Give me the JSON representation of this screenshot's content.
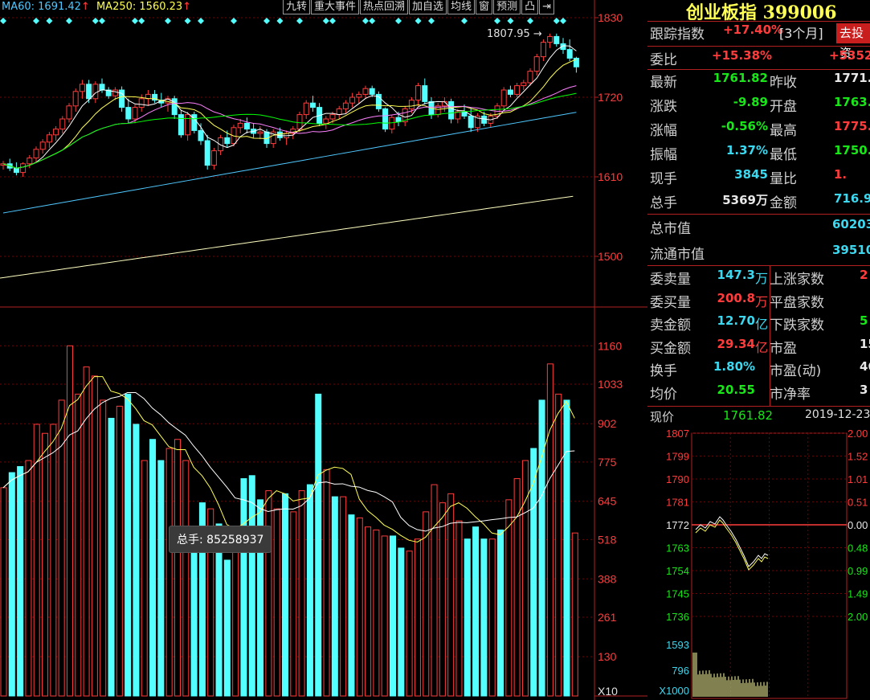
{
  "ma_legend": {
    "ma60": "MA60: 1691.42",
    "ma250": "MA250: 1560.23",
    "arrow": "↑",
    "ma60_color": "#4fc8ff",
    "ma250_color": "#ffff54"
  },
  "toolbar": [
    "九转",
    "重大事件",
    "热点回溯",
    "加自选",
    "均线",
    "窗",
    "预测",
    "凸",
    "⇥"
  ],
  "price_axis": {
    "labels": [
      "1830",
      "1720",
      "1610",
      "1500"
    ],
    "min": 1430,
    "max": 1830
  },
  "peak_label": "1807.95",
  "volume_axis": {
    "labels": [
      "1160",
      "1033",
      "902",
      "775",
      "645",
      "518",
      "388",
      "261",
      "130",
      "X10"
    ]
  },
  "tooltip": {
    "text": "总手: 85258937"
  },
  "index": {
    "title": "创业板指 399006"
  },
  "quote": {
    "track": {
      "label": "跟踪指数",
      "value": "+17.40%",
      "period": "[3个月]",
      "button": "去投资"
    },
    "weibi": {
      "label": "委比",
      "value": "+15.38%",
      "value2": "+5352"
    },
    "rows": [
      {
        "l1": "最新",
        "v1": "1761.82",
        "c1": "grn",
        "l2": "昨收",
        "v2": "1771.",
        "c2": "wht"
      },
      {
        "l1": "涨跌",
        "v1": "-9.89",
        "c1": "grn",
        "l2": "开盘",
        "v2": "1763.",
        "c2": "grn"
      },
      {
        "l1": "涨幅",
        "v1": "-0.56%",
        "c1": "grn",
        "l2": "最高",
        "v2": "1775.",
        "c2": "red"
      },
      {
        "l1": "振幅",
        "v1": "1.37%",
        "c1": "cyn",
        "l2": "最低",
        "v2": "1750.",
        "c2": "grn"
      },
      {
        "l1": "现手",
        "v1": "3845",
        "c1": "cyn",
        "l2": "量比",
        "v2": "1.",
        "c2": "red"
      },
      {
        "l1": "总手",
        "v1": "5369万",
        "c1": "wht",
        "l2": "金额",
        "v2": "716.9",
        "c2": "cyn"
      }
    ],
    "mktcap": {
      "label": "总市值",
      "value": "60203"
    },
    "floatcap": {
      "label": "流通市值",
      "value": "39510"
    },
    "rows2": [
      {
        "l1": "委卖量",
        "v1": "147.3",
        "u1": "万",
        "c1": "cyn",
        "l2": "上涨家数",
        "v2": "2",
        "c2": "red"
      },
      {
        "l1": "委买量",
        "v1": "200.8",
        "u1": "万",
        "c1": "red",
        "l2": "平盘家数",
        "v2": "",
        "c2": "wht"
      },
      {
        "l1": "卖金额",
        "v1": "12.70",
        "u1": "亿",
        "c1": "cyn",
        "l2": "下跌家数",
        "v2": "5",
        "c2": "grn"
      },
      {
        "l1": "买金额",
        "v1": "29.34",
        "u1": "亿",
        "c1": "red",
        "l2": "市盈",
        "v2": "15",
        "c2": "wht"
      },
      {
        "l1": "换手",
        "v1": "1.80%",
        "u1": "",
        "c1": "cyn",
        "l2": "市盈(动)",
        "v2": "46",
        "c2": "wht"
      },
      {
        "l1": "均价",
        "v1": "20.55",
        "u1": "",
        "c1": "grn",
        "l2": "市净率",
        "v2": "3",
        "c2": "wht"
      }
    ]
  },
  "mini": {
    "label": "现价",
    "price": "1761.82",
    "date": "2019-12-23",
    "left_labels": [
      "1807",
      "1799",
      "1790",
      "1781",
      "1772",
      "1763",
      "1754",
      "1745",
      "1736"
    ],
    "right_labels": [
      "2.00",
      "1.52",
      "1.01",
      "0.51",
      "0.00",
      "0.48",
      "0.99",
      "1.49",
      "2.00"
    ],
    "vol_labels": [
      "1593",
      "796",
      "X1000"
    ]
  },
  "colors": {
    "up": "#ff3c3c",
    "down": "#54ffff",
    "ma5": "#ffffff",
    "ma10": "#ffff54",
    "ma20": "#ff80ff",
    "ma30": "#00ff00",
    "ma60": "#4fc8ff",
    "ma250": "#ffffc0",
    "grid": "#7a0000"
  },
  "chart_data": {
    "type": "candlestick",
    "price_ylim": [
      1430,
      1830
    ],
    "candles": [
      [
        1626,
        1632,
        1620,
        1628
      ],
      [
        1628,
        1635,
        1618,
        1622
      ],
      [
        1622,
        1630,
        1612,
        1616
      ],
      [
        1616,
        1630,
        1610,
        1628
      ],
      [
        1628,
        1640,
        1622,
        1636
      ],
      [
        1636,
        1652,
        1630,
        1648
      ],
      [
        1648,
        1662,
        1642,
        1658
      ],
      [
        1658,
        1672,
        1650,
        1668
      ],
      [
        1668,
        1680,
        1660,
        1676
      ],
      [
        1676,
        1694,
        1670,
        1690
      ],
      [
        1690,
        1712,
        1685,
        1708
      ],
      [
        1708,
        1732,
        1700,
        1728
      ],
      [
        1728,
        1744,
        1718,
        1738
      ],
      [
        1738,
        1744,
        1712,
        1718
      ],
      [
        1718,
        1742,
        1712,
        1738
      ],
      [
        1738,
        1746,
        1726,
        1730
      ],
      [
        1730,
        1734,
        1718,
        1722
      ],
      [
        1722,
        1734,
        1716,
        1730
      ],
      [
        1730,
        1735,
        1700,
        1706
      ],
      [
        1706,
        1718,
        1684,
        1690
      ],
      [
        1690,
        1710,
        1684,
        1706
      ],
      [
        1706,
        1724,
        1700,
        1718
      ],
      [
        1718,
        1730,
        1708,
        1724
      ],
      [
        1724,
        1730,
        1712,
        1716
      ],
      [
        1716,
        1726,
        1706,
        1712
      ],
      [
        1712,
        1722,
        1700,
        1718
      ],
      [
        1718,
        1722,
        1690,
        1696
      ],
      [
        1696,
        1702,
        1664,
        1668
      ],
      [
        1668,
        1700,
        1660,
        1696
      ],
      [
        1696,
        1700,
        1670,
        1674
      ],
      [
        1674,
        1684,
        1654,
        1660
      ],
      [
        1660,
        1668,
        1620,
        1626
      ],
      [
        1626,
        1650,
        1620,
        1646
      ],
      [
        1646,
        1668,
        1640,
        1664
      ],
      [
        1664,
        1674,
        1650,
        1656
      ],
      [
        1656,
        1682,
        1652,
        1678
      ],
      [
        1678,
        1690,
        1670,
        1684
      ],
      [
        1684,
        1692,
        1670,
        1676
      ],
      [
        1676,
        1684,
        1664,
        1670
      ],
      [
        1670,
        1680,
        1662,
        1672
      ],
      [
        1672,
        1676,
        1650,
        1656
      ],
      [
        1656,
        1676,
        1650,
        1672
      ],
      [
        1672,
        1678,
        1660,
        1664
      ],
      [
        1664,
        1674,
        1654,
        1670
      ],
      [
        1670,
        1680,
        1662,
        1676
      ],
      [
        1676,
        1700,
        1672,
        1696
      ],
      [
        1696,
        1716,
        1690,
        1712
      ],
      [
        1712,
        1722,
        1700,
        1706
      ],
      [
        1706,
        1712,
        1680,
        1684
      ],
      [
        1684,
        1694,
        1676,
        1690
      ],
      [
        1690,
        1700,
        1684,
        1696
      ],
      [
        1696,
        1708,
        1690,
        1704
      ],
      [
        1704,
        1716,
        1698,
        1712
      ],
      [
        1712,
        1726,
        1706,
        1720
      ],
      [
        1720,
        1728,
        1712,
        1724
      ],
      [
        1724,
        1736,
        1718,
        1732
      ],
      [
        1732,
        1736,
        1720,
        1724
      ],
      [
        1724,
        1728,
        1700,
        1704
      ],
      [
        1704,
        1706,
        1672,
        1676
      ],
      [
        1676,
        1696,
        1670,
        1692
      ],
      [
        1692,
        1700,
        1680,
        1686
      ],
      [
        1686,
        1708,
        1680,
        1704
      ],
      [
        1704,
        1720,
        1698,
        1716
      ],
      [
        1716,
        1740,
        1708,
        1736
      ],
      [
        1736,
        1746,
        1710,
        1714
      ],
      [
        1714,
        1720,
        1690,
        1696
      ],
      [
        1696,
        1712,
        1692,
        1708
      ],
      [
        1708,
        1720,
        1700,
        1714
      ],
      [
        1714,
        1718,
        1684,
        1690
      ],
      [
        1690,
        1704,
        1684,
        1700
      ],
      [
        1700,
        1710,
        1690,
        1694
      ],
      [
        1694,
        1706,
        1672,
        1678
      ],
      [
        1678,
        1698,
        1672,
        1694
      ],
      [
        1694,
        1700,
        1680,
        1684
      ],
      [
        1684,
        1698,
        1678,
        1694
      ],
      [
        1694,
        1712,
        1690,
        1708
      ],
      [
        1708,
        1734,
        1702,
        1730
      ],
      [
        1730,
        1736,
        1720,
        1724
      ],
      [
        1724,
        1740,
        1720,
        1736
      ],
      [
        1736,
        1744,
        1730,
        1740
      ],
      [
        1740,
        1760,
        1736,
        1756
      ],
      [
        1756,
        1780,
        1750,
        1776
      ],
      [
        1776,
        1800,
        1770,
        1796
      ],
      [
        1796,
        1808,
        1788,
        1804
      ],
      [
        1804,
        1808,
        1790,
        1794
      ],
      [
        1794,
        1802,
        1780,
        1786
      ],
      [
        1786,
        1800,
        1770,
        1774
      ],
      [
        1774,
        1776,
        1754,
        1762
      ]
    ],
    "volumes": [
      690,
      740,
      760,
      780,
      900,
      870,
      900,
      980,
      1160,
      1000,
      1090,
      1060,
      980,
      920,
      960,
      1000,
      900,
      780,
      850,
      780,
      820,
      850,
      780,
      560,
      640,
      620,
      570,
      450,
      490,
      720,
      730,
      650,
      680,
      620,
      670,
      610,
      680,
      700,
      1000,
      750,
      660,
      660,
      600,
      590,
      560,
      550,
      530,
      530,
      490,
      480,
      520,
      610,
      700,
      640,
      670,
      580,
      520,
      560,
      520,
      520,
      550,
      650,
      720,
      780,
      820,
      980,
      1100,
      1000,
      980,
      540
    ],
    "volume_ylim": [
      0,
      1230
    ],
    "peak": 1807.95
  }
}
